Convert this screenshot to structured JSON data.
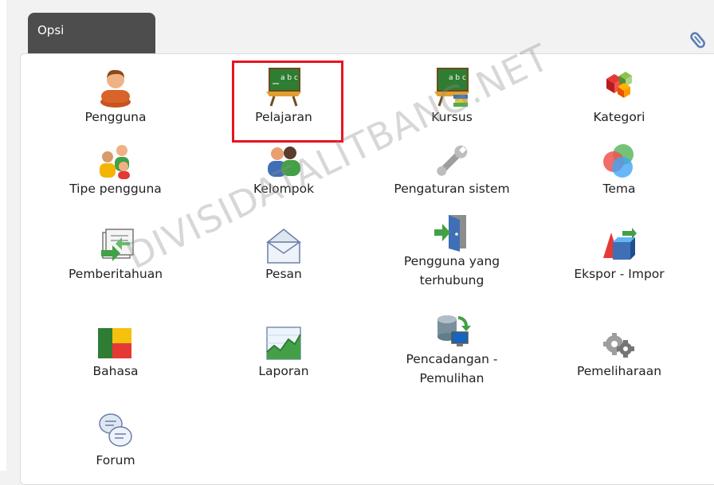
{
  "header": {
    "tab_label": "Opsi"
  },
  "watermark": "DIVISIDATALITBANG.NET",
  "colors": {
    "highlight": "#e8141e",
    "tab_bg": "#4d4d4d"
  },
  "options": [
    {
      "label": "Pengguna",
      "icon": "user-icon"
    },
    {
      "label": "Pelajaran",
      "icon": "blackboard-icon",
      "highlighted": true
    },
    {
      "label": "Kursus",
      "icon": "blackboard-books-icon"
    },
    {
      "label": "Kategori",
      "icon": "cubes-icon"
    },
    {
      "label": "Tipe pengguna",
      "icon": "user-types-icon"
    },
    {
      "label": "Kelompok",
      "icon": "group-icon"
    },
    {
      "label": "Pengaturan sistem",
      "icon": "wrench-icon"
    },
    {
      "label": "Tema",
      "icon": "color-circles-icon"
    },
    {
      "label": "Pemberitahuan",
      "icon": "notification-icon"
    },
    {
      "label": "Pesan",
      "icon": "envelope-icon"
    },
    {
      "label": "Pengguna yang\nterhubung",
      "icon": "door-exit-icon"
    },
    {
      "label": "Ekspor - Impor",
      "icon": "export-import-icon"
    },
    {
      "label": "Bahasa",
      "icon": "language-flag-icon"
    },
    {
      "label": "Laporan",
      "icon": "chart-report-icon"
    },
    {
      "label": "Pencadangan -\nPemulihan",
      "icon": "database-backup-icon"
    },
    {
      "label": "Pemeliharaan",
      "icon": "gears-icon"
    },
    {
      "label": "Forum",
      "icon": "chat-bubbles-icon"
    }
  ]
}
